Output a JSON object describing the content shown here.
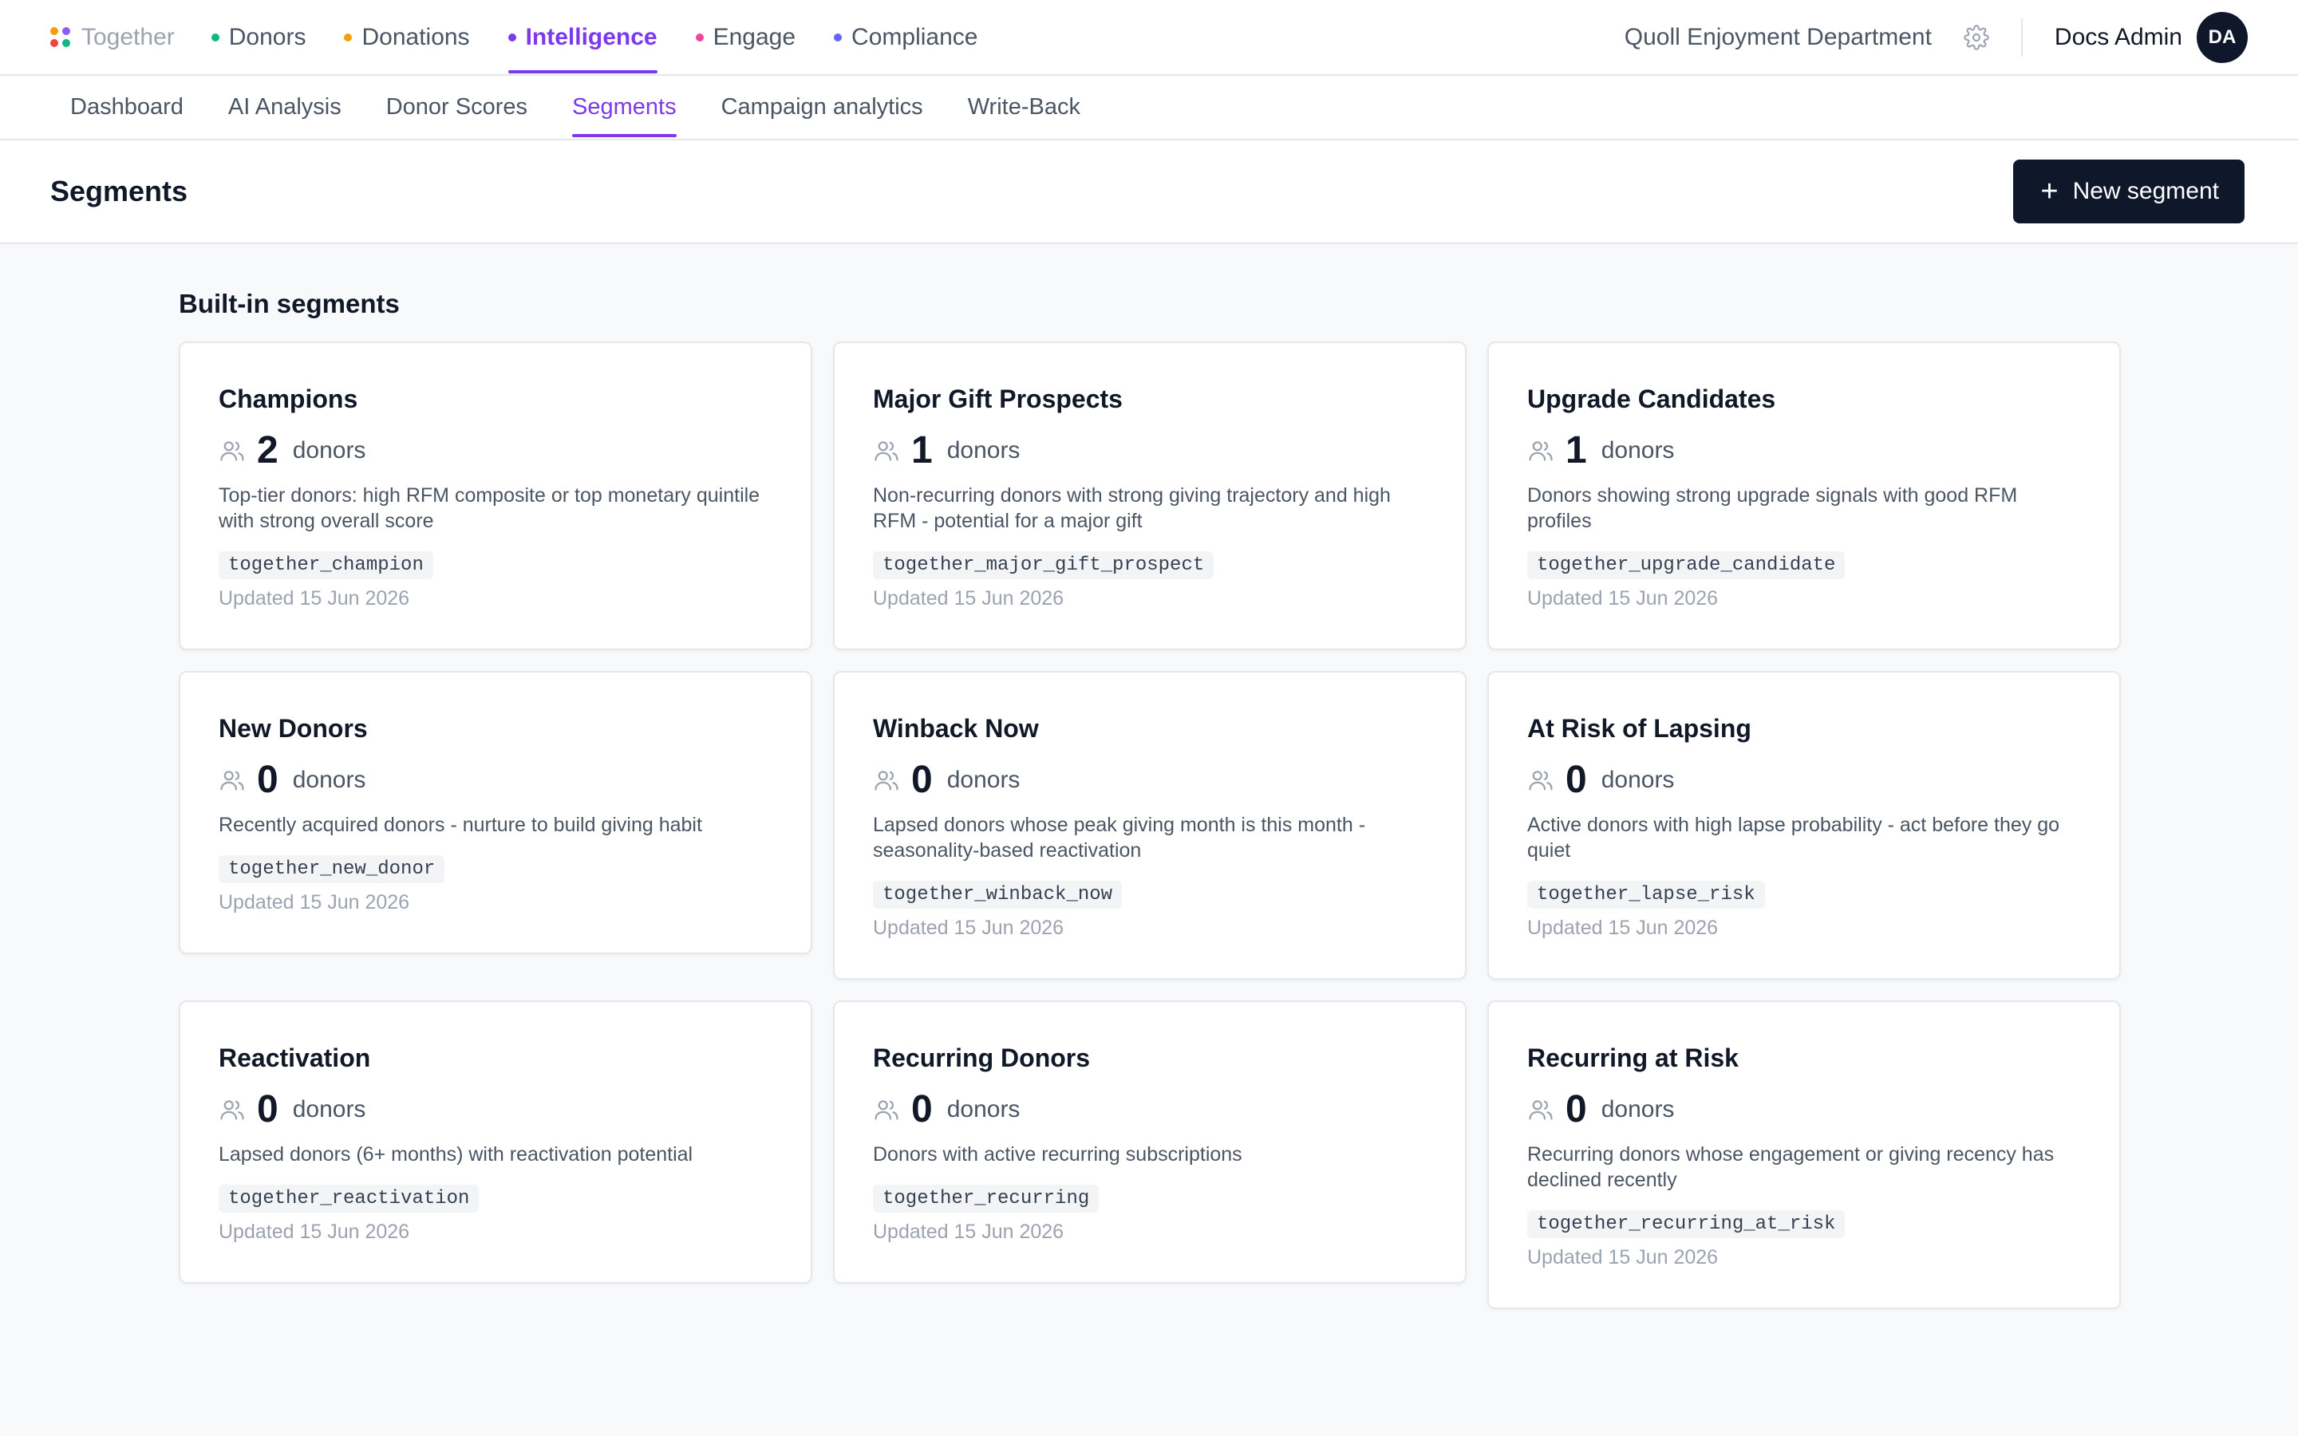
{
  "brand": {
    "name": "Together",
    "logo_colors": [
      "#f59e0b",
      "#8b5cf6",
      "#ef4444",
      "#10b981"
    ]
  },
  "main_nav": [
    {
      "label": "Donors",
      "dot_color": "#10b981",
      "active": false
    },
    {
      "label": "Donations",
      "dot_color": "#f59e0b",
      "active": false
    },
    {
      "label": "Intelligence",
      "dot_color": "#7c3aed",
      "active": true
    },
    {
      "label": "Engage",
      "dot_color": "#ec4899",
      "active": false
    },
    {
      "label": "Compliance",
      "dot_color": "#6366f1",
      "active": false
    }
  ],
  "header_right": {
    "org_name": "Quoll Enjoyment Department",
    "settings_icon": "gear-icon",
    "user_name": "Docs Admin",
    "avatar_initials": "DA"
  },
  "sub_nav": [
    {
      "label": "Dashboard",
      "active": false
    },
    {
      "label": "AI Analysis",
      "active": false
    },
    {
      "label": "Donor Scores",
      "active": false
    },
    {
      "label": "Segments",
      "active": true
    },
    {
      "label": "Campaign analytics",
      "active": false
    },
    {
      "label": "Write-Back",
      "active": false
    }
  ],
  "page": {
    "title": "Segments",
    "new_button_label": "New segment"
  },
  "builtin": {
    "section_title": "Built-in segments",
    "cards": [
      {
        "title": "Champions",
        "count": "2",
        "unit": "donors",
        "description": "Top-tier donors: high RFM composite or top monetary quintile with strong overall score",
        "slug": "together_champion",
        "updated": "Updated 15 Jun 2026"
      },
      {
        "title": "Major Gift Prospects",
        "count": "1",
        "unit": "donors",
        "description": "Non-recurring donors with strong giving trajectory and high RFM - potential for a major gift",
        "slug": "together_major_gift_prospect",
        "updated": "Updated 15 Jun 2026"
      },
      {
        "title": "Upgrade Candidates",
        "count": "1",
        "unit": "donors",
        "description": "Donors showing strong upgrade signals with good RFM profiles",
        "slug": "together_upgrade_candidate",
        "updated": "Updated 15 Jun 2026"
      },
      {
        "title": "New Donors",
        "count": "0",
        "unit": "donors",
        "description": "Recently acquired donors - nurture to build giving habit",
        "slug": "together_new_donor",
        "updated": "Updated 15 Jun 2026"
      },
      {
        "title": "Winback Now",
        "count": "0",
        "unit": "donors",
        "description": "Lapsed donors whose peak giving month is this month - seasonality-based reactivation",
        "slug": "together_winback_now",
        "updated": "Updated 15 Jun 2026"
      },
      {
        "title": "At Risk of Lapsing",
        "count": "0",
        "unit": "donors",
        "description": "Active donors with high lapse probability - act before they go quiet",
        "slug": "together_lapse_risk",
        "updated": "Updated 15 Jun 2026"
      },
      {
        "title": "Reactivation",
        "count": "0",
        "unit": "donors",
        "description": "Lapsed donors (6+ months) with reactivation potential",
        "slug": "together_reactivation",
        "updated": "Updated 15 Jun 2026"
      },
      {
        "title": "Recurring Donors",
        "count": "0",
        "unit": "donors",
        "description": "Donors with active recurring subscriptions",
        "slug": "together_recurring",
        "updated": "Updated 15 Jun 2026"
      },
      {
        "title": "Recurring at Risk",
        "count": "0",
        "unit": "donors",
        "description": "Recurring donors whose engagement or giving recency has declined recently",
        "slug": "together_recurring_at_risk",
        "updated": "Updated 15 Jun 2026"
      }
    ]
  }
}
